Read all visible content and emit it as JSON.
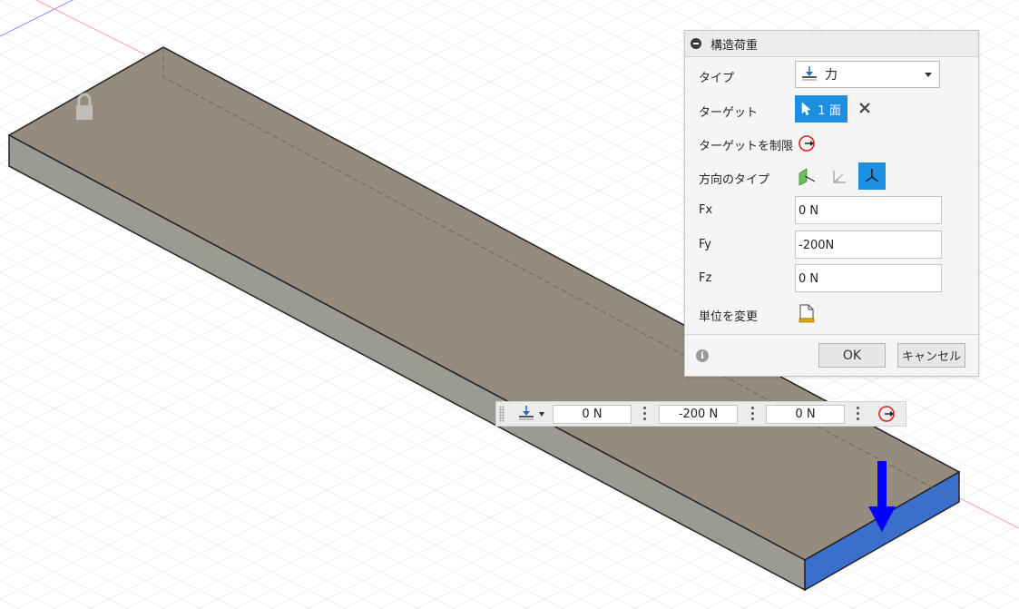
{
  "dialog": {
    "title": "構造荷重",
    "type_label": "タイプ",
    "type_value": "力",
    "target_label": "ターゲット",
    "target_value": "1 面",
    "restrict_label": "ターゲットを制限",
    "direction_label": "方向のタイプ",
    "fx_label": "Fx",
    "fx_value": "0 N",
    "fy_label": "Fy",
    "fy_value": "-200N",
    "fz_label": "Fz",
    "fz_value": "0 N",
    "units_label": "単位を変更",
    "ok_label": "OK",
    "cancel_label": "キャンセル",
    "info_glyph": "i"
  },
  "toolbar": {
    "fx_value": "0 N",
    "fy_value": "-200 N",
    "fz_value": "0 N"
  },
  "colors": {
    "accent": "#1c8fe0",
    "selected_face": "#3a6fcc",
    "load_arrow": "#0000ff",
    "body_top": "#958c7f",
    "body_side": "#9b9a93"
  },
  "icons": {
    "lock": "lock-icon",
    "force": "force-load-icon",
    "cursor": "cursor-select-icon",
    "close": "close-icon",
    "restrict": "restrict-target-icon",
    "dir_normal": "direction-normal-icon",
    "dir_angle": "direction-angle-icon",
    "dir_components": "direction-components-icon",
    "units": "change-units-icon",
    "info": "info-icon"
  }
}
